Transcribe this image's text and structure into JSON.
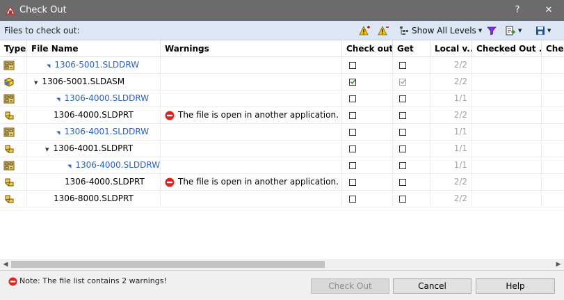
{
  "window": {
    "title": "Check Out",
    "help_label": "?",
    "close_label": "✕"
  },
  "toolbar": {
    "label": "Files to check out:",
    "show_all_levels": "Show All Levels"
  },
  "columns": {
    "type": "Type",
    "file_name": "File Name",
    "warnings": "Warnings",
    "check_out": "Check out",
    "get": "Get",
    "local_version": "Local v...",
    "checked_out_by": "Checked Out ...",
    "checked_in": "Chec"
  },
  "rows": [
    {
      "icon": "drawing-icon",
      "name": "1306-5001.SLDDRW",
      "warning": "",
      "check_out": false,
      "get": false,
      "local": "2/2"
    },
    {
      "icon": "assembly-icon",
      "name": "1306-5001.SLDASM",
      "warning": "",
      "check_out": true,
      "get": true,
      "local": "2/2"
    },
    {
      "icon": "drawing-icon",
      "name": "1306-4000.SLDDRW",
      "warning": "",
      "check_out": false,
      "get": false,
      "local": "1/1"
    },
    {
      "icon": "part-icon",
      "name": "1306-4000.SLDPRT",
      "warning": "The file is open in another application.",
      "check_out": false,
      "get": false,
      "local": "2/2"
    },
    {
      "icon": "drawing-icon",
      "name": "1306-4001.SLDDRW",
      "warning": "",
      "check_out": false,
      "get": false,
      "local": "1/1"
    },
    {
      "icon": "part-icon",
      "name": "1306-4001.SLDPRT",
      "warning": "",
      "check_out": false,
      "get": false,
      "local": "1/1"
    },
    {
      "icon": "drawing-icon",
      "name": "1306-4000.SLDDRW",
      "warning": "",
      "check_out": false,
      "get": false,
      "local": "1/1"
    },
    {
      "icon": "part-icon",
      "name": "1306-4000.SLDPRT",
      "warning": "The file is open in another application.",
      "check_out": false,
      "get": false,
      "local": "2/2"
    },
    {
      "icon": "part-icon",
      "name": "1306-8000.SLDPRT",
      "warning": "",
      "check_out": false,
      "get": false,
      "local": "2/2"
    }
  ],
  "footer": {
    "note": "Note: The file list contains 2 warnings!",
    "check_out_button": "Check Out",
    "cancel_button": "Cancel",
    "help_button": "Help"
  },
  "colors": {
    "titlebar": "#6b6b6b",
    "toolbar": "#dce6f4",
    "drawing_link": "#2e5fb8",
    "warning_red": "#d9261c",
    "checkbox_check": "#1a8c1a"
  }
}
